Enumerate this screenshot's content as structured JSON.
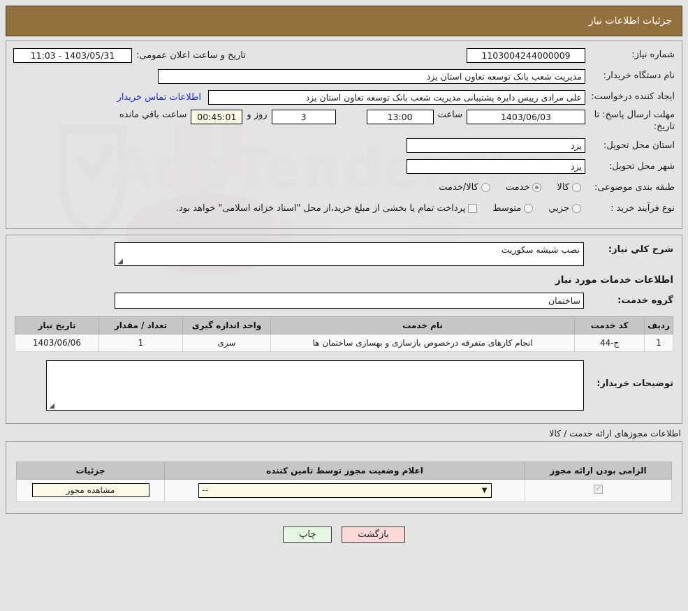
{
  "header": {
    "title": "جزئیات اطلاعات نیاز"
  },
  "form": {
    "need_number_label": "شماره نیاز:",
    "need_number_value": "1103004244000009",
    "announce_label": "تاریخ و ساعت اعلان عمومی:",
    "announce_value": "1403/05/31 - 11:03",
    "buyer_org_label": "نام دستگاه خریدار:",
    "buyer_org_value": "مدیریت شعب بانک توسعه تعاون استان یزد",
    "creator_label": "ایجاد کننده درخواست:",
    "creator_value": "علی مرادی رییس دایره پشتیبانی مدیریت شعب بانک توسعه تعاون استان یزد",
    "contact_link": "اطلاعات تماس خریدار",
    "deadline_label": "مهلت ارسال پاسخ: تا تاریخ:",
    "deadline_date": "1403/06/03",
    "hour_label": "ساعت",
    "hour_value": "13:00",
    "days_value": "3",
    "days_label": "روز و",
    "remaining_value": "00:45:01",
    "remaining_label": "ساعت باقي مانده",
    "province_label": "استان محل تحویل:",
    "province_value": "یزد",
    "city_label": "شهر محل تحویل:",
    "city_value": "یزد",
    "category_label": "طبقه بندی موضوعی:",
    "category_options": [
      {
        "label": "کالا",
        "selected": false
      },
      {
        "label": "خدمت",
        "selected": true
      },
      {
        "label": "کالا/خدمت",
        "selected": false
      }
    ],
    "process_label": "نوع فرآیند خرید :",
    "process_options": [
      {
        "label": "جزیي",
        "selected": false
      },
      {
        "label": "متوسط",
        "selected": false
      }
    ],
    "treasury_note": "پرداخت تمام یا بخشی از مبلغ خرید،از محل \"اسناد خزانه اسلامی\" خواهد بود.",
    "general_desc_label": "شرح کلي نیاز:",
    "general_desc_value": "نصب شیشه سکوریت"
  },
  "services": {
    "section_title": "اطلاعات خدمات مورد نیاز",
    "group_label": "گروه خدمت:",
    "group_value": "ساختمان",
    "columns": [
      "ردیف",
      "کد خدمت",
      "نام خدمت",
      "واحد اندازه گیری",
      "تعداد / مقدار",
      "تاریخ نیاز"
    ],
    "rows": [
      {
        "index": "1",
        "code": "ج-44",
        "name": "انجام کارهای متفرقه درخصوص بازسازی و بهسازی ساختمان ها",
        "unit": "سری",
        "qty": "1",
        "date": "1403/06/06"
      }
    ],
    "buyer_notes_label": "توضیحات خریدار:",
    "buyer_notes_value": ""
  },
  "permits": {
    "section_note": "اطلاعات مجوزهای ارائه خدمت / کالا",
    "columns": [
      "الزامی بودن ارائه مجوز",
      "اعلام وضعیت مجوز توسط تامین کننده",
      "جزئیات"
    ],
    "rows": [
      {
        "required_checked": true,
        "status_value": "--",
        "details_button": "مشاهده مجوز"
      }
    ]
  },
  "footer": {
    "print_label": "چاپ",
    "back_label": "بازگشت"
  },
  "watermark": {
    "text": "AnaTender.Net"
  }
}
